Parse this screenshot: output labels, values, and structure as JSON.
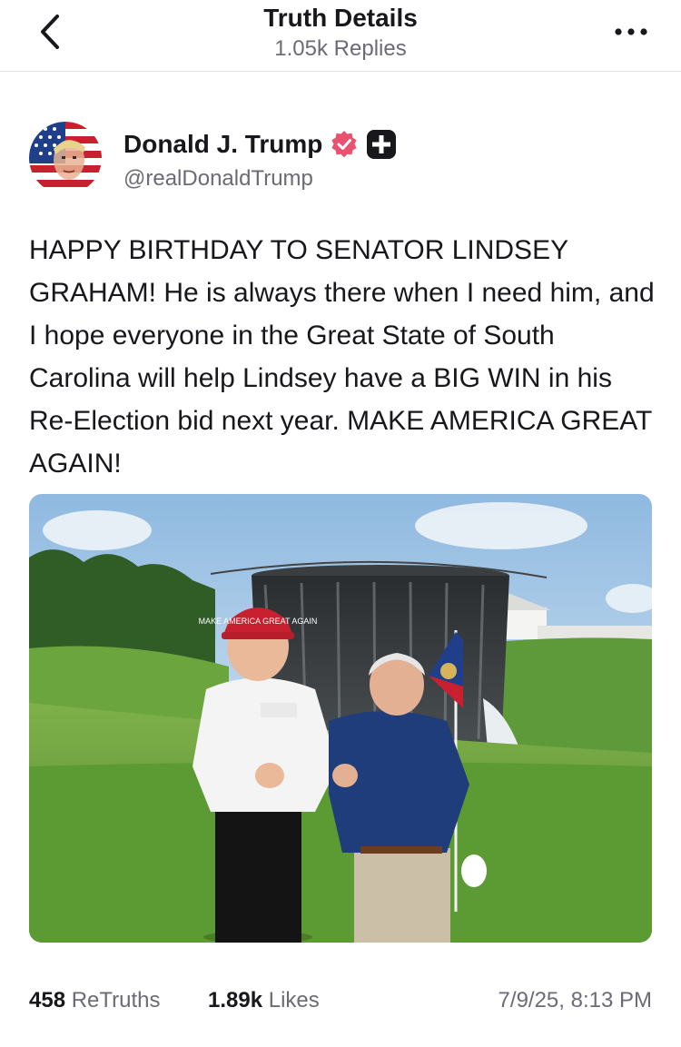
{
  "header": {
    "title": "Truth Details",
    "subtitle": "1.05k Replies",
    "back_icon": "chevron-left-icon",
    "more_icon": "ellipsis-icon"
  },
  "author": {
    "name": "Donald J. Trump",
    "handle": "@realDonaldTrump",
    "verified_icon": "verified-badge-icon",
    "plus_icon": "plus-badge-icon",
    "colors": {
      "verified": "#e8516f",
      "plus": "#17171c"
    }
  },
  "post": {
    "text": "HAPPY BIRTHDAY TO SENATOR LINDSEY GRAHAM! He is always there when I need him, and I hope everyone in the Great State of South Carolina will help Lindsey have a BIG WIN in his Re-Election bid next year. MAKE AMERICA GREAT AGAIN!",
    "image": {
      "hat_text": "MAKE AMERICA GREAT AGAIN"
    }
  },
  "stats": {
    "retruths_count": "458",
    "retruths_label": "ReTruths",
    "likes_count": "1.89k",
    "likes_label": "Likes",
    "timestamp": "7/9/25, 8:13 PM"
  }
}
